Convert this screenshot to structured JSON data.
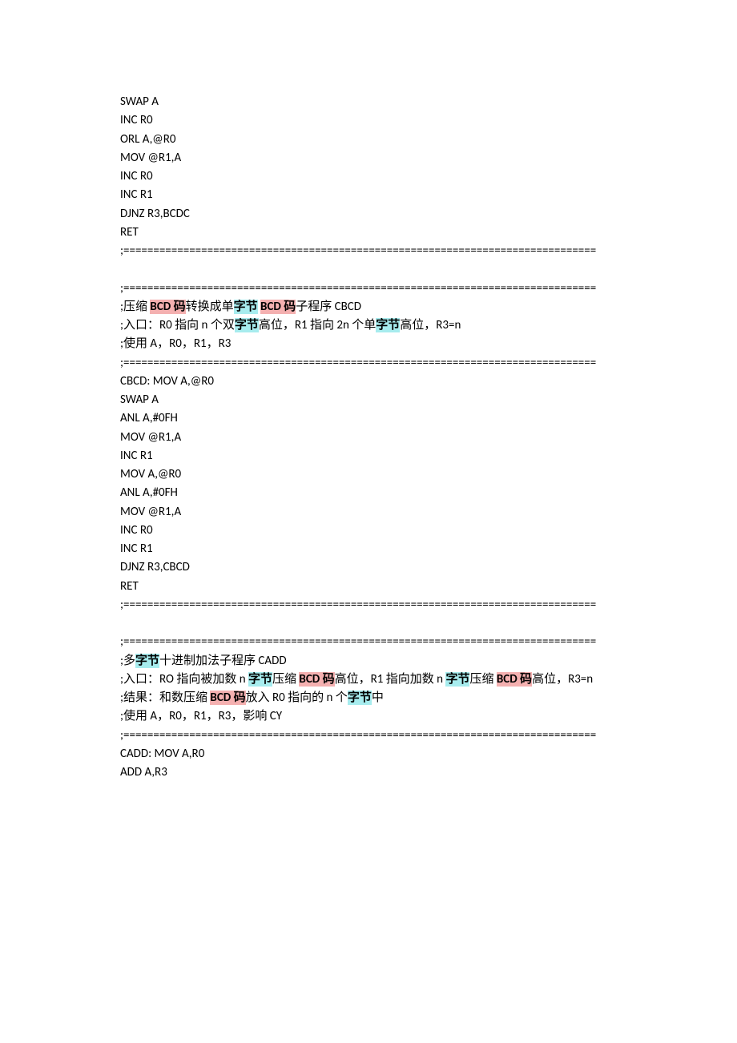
{
  "lines": [
    {
      "text": "SWAP A"
    },
    {
      "text": "INC R0"
    },
    {
      "text": "ORL A,@R0"
    },
    {
      "text": "MOV @R1,A"
    },
    {
      "text": "INC R0"
    },
    {
      "text": "INC R1"
    },
    {
      "text": "DJNZ R3,BCDC"
    },
    {
      "text": "RET"
    },
    {
      "text": ";==============================================================================="
    },
    {
      "text": ""
    },
    {
      "text": ";==============================================================================="
    },
    {
      "parts": [
        {
          "t": ";压缩 "
        },
        {
          "t": "BCD 码",
          "hl": "red"
        },
        {
          "t": "转换成单"
        },
        {
          "t": "字节",
          "hl": "cyan"
        },
        {
          "t": " "
        },
        {
          "t": "BCD 码",
          "hl": "red"
        },
        {
          "t": "子程序 CBCD"
        }
      ]
    },
    {
      "parts": [
        {
          "t": ";入口：R0 指向 n 个双"
        },
        {
          "t": "字节",
          "hl": "cyan"
        },
        {
          "t": "高位，R1 指向 2n 个单"
        },
        {
          "t": "字节",
          "hl": "cyan"
        },
        {
          "t": "高位，R3=n"
        }
      ]
    },
    {
      "text": ";使用 A，R0，R1，R3"
    },
    {
      "text": ";==============================================================================="
    },
    {
      "text": "CBCD: MOV A,@R0"
    },
    {
      "text": "SWAP A"
    },
    {
      "text": "ANL A,#0FH"
    },
    {
      "text": "MOV @R1,A"
    },
    {
      "text": "INC R1"
    },
    {
      "text": "MOV A,@R0"
    },
    {
      "text": "ANL A,#0FH"
    },
    {
      "text": "MOV @R1,A"
    },
    {
      "text": "INC R0"
    },
    {
      "text": "INC R1"
    },
    {
      "text": "DJNZ R3,CBCD"
    },
    {
      "text": "RET"
    },
    {
      "text": ";==============================================================================="
    },
    {
      "text": ""
    },
    {
      "text": ";==============================================================================="
    },
    {
      "parts": [
        {
          "t": ";多"
        },
        {
          "t": "字节",
          "hl": "cyan"
        },
        {
          "t": "十进制加法子程序 CADD"
        }
      ]
    },
    {
      "parts": [
        {
          "t": ";入口：RO 指向被加数 n "
        },
        {
          "t": "字节",
          "hl": "cyan"
        },
        {
          "t": "压缩 "
        },
        {
          "t": "BCD 码",
          "hl": "red"
        },
        {
          "t": "高位，R1 指向加数 n "
        },
        {
          "t": "字节",
          "hl": "cyan"
        },
        {
          "t": "压缩 "
        },
        {
          "t": "BCD 码",
          "hl": "red"
        },
        {
          "t": "高位，R3=n"
        }
      ]
    },
    {
      "parts": [
        {
          "t": ";结果：和数压缩 "
        },
        {
          "t": "BCD 码",
          "hl": "red"
        },
        {
          "t": "放入 R0 指向的 n 个"
        },
        {
          "t": "字节",
          "hl": "cyan"
        },
        {
          "t": "中"
        }
      ]
    },
    {
      "text": ";使用 A，R0，R1，R3，影响 CY"
    },
    {
      "text": ";==============================================================================="
    },
    {
      "text": "CADD: MOV A,R0"
    },
    {
      "text": "ADD A,R3"
    }
  ]
}
